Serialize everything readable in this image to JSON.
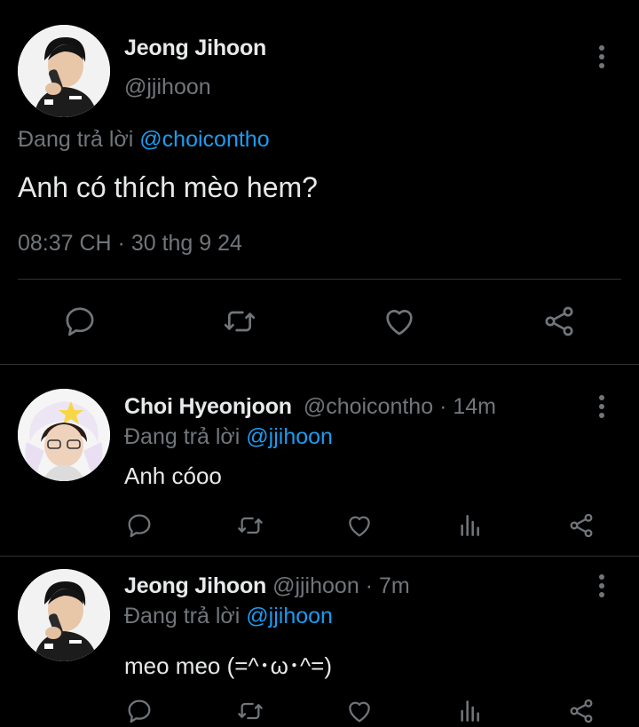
{
  "main_tweet": {
    "display_name": "Jeong Jihoon",
    "handle": "@jjihoon",
    "reply_prefix": "Đang trả lời",
    "reply_to": "@choicontho",
    "text": "Anh có thích mèo hem?",
    "timestamp": "08:37 CH · 30 thg 9 24"
  },
  "replies": [
    {
      "display_name": "Choi Hyeonjoon",
      "handle": "@choicontho",
      "time": "· 14m",
      "reply_prefix": "Đang trả lời",
      "reply_to": "@jjihoon",
      "text": "Anh cóoo"
    },
    {
      "display_name": "Jeong Jihoon",
      "handle": "@jjihoon",
      "time": "· 7m",
      "reply_prefix": "Đang trả lời",
      "reply_to": "@jjihoon",
      "text": "meo meo (=^･ω･^=)"
    }
  ],
  "icons": {
    "reply": "reply-icon",
    "retweet": "retweet-icon",
    "like": "heart-icon",
    "views": "views-icon",
    "share": "share-icon",
    "more": "more-icon"
  },
  "colors": {
    "background": "#000000",
    "text": "#e7e9ea",
    "muted": "#71767b",
    "link": "#1d9bf0",
    "divider": "#2f3336"
  }
}
